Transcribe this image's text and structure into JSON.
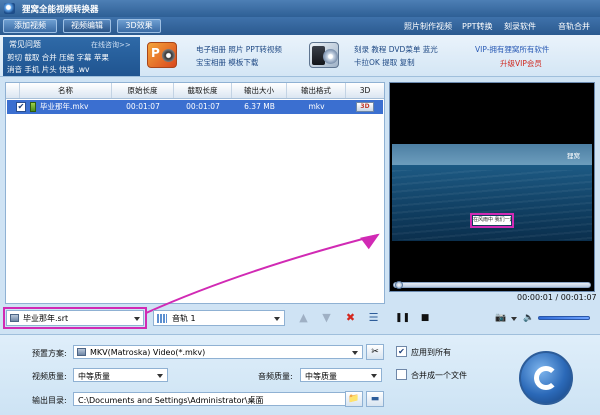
{
  "window": {
    "title": "狸窝全能视频转换器"
  },
  "tabs": [
    {
      "label": "添加视频"
    },
    {
      "label": "视频编辑"
    },
    {
      "label": "3D效果"
    }
  ],
  "top_links": [
    "照片制作视频",
    "PPT转换",
    "刻录软件",
    "音轨合并"
  ],
  "faq": {
    "title": "常见问题",
    "online": "在线咨询>>",
    "line1": "剪切 截取 合并 压缩 字幕 苹果",
    "line2": "消音 手机 片头 快播 .wv"
  },
  "promo": {
    "group1_line1": "电子相册 照片 PPT转视频",
    "group1_line2": "宝宝相册 模板下载",
    "group2_line1": "刻录 教程 DVD菜单 蓝光",
    "group2_line2": "卡拉OK 提取 复制",
    "vip_line1": "VIP-拥有狸窝所有软件",
    "vip_line2": "升级VIP会员"
  },
  "table": {
    "headers": [
      "名称",
      "原始长度",
      "截取长度",
      "输出大小",
      "输出格式",
      "3D"
    ],
    "rows": [
      {
        "name": "毕业那年.mkv",
        "orig": "00:01:07",
        "cut": "00:01:07",
        "size": "6.37 MB",
        "format": "mkv",
        "badge": "3D"
      }
    ]
  },
  "subtitle_select": {
    "value": "毕业那年.srt"
  },
  "audio_select": {
    "value": "音轨 1"
  },
  "preview": {
    "watermark": "狸窝",
    "subtitle_text": "在风雨中 我们一起走过",
    "time": "00:00:01 / 00:01:07",
    "progress": 0.01
  },
  "settings": {
    "preset_label": "预置方案:",
    "preset_value": "MKV(Matroska) Video(*.mkv)",
    "apply_all_label": "应用到所有",
    "apply_all_checked": true,
    "video_quality_label": "视频质量:",
    "video_quality_value": "中等质量",
    "audio_quality_label": "音频质量:",
    "audio_quality_value": "中等质量",
    "merge_label": "合并成一个文件",
    "merge_checked": false,
    "output_label": "输出目录:",
    "output_value": "C:\\Documents and Settings\\Administrator\\桌面"
  },
  "colors": {
    "accent": "#3b6fd0",
    "highlight": "#d12ab4",
    "title_bar": "#2e5f95"
  }
}
